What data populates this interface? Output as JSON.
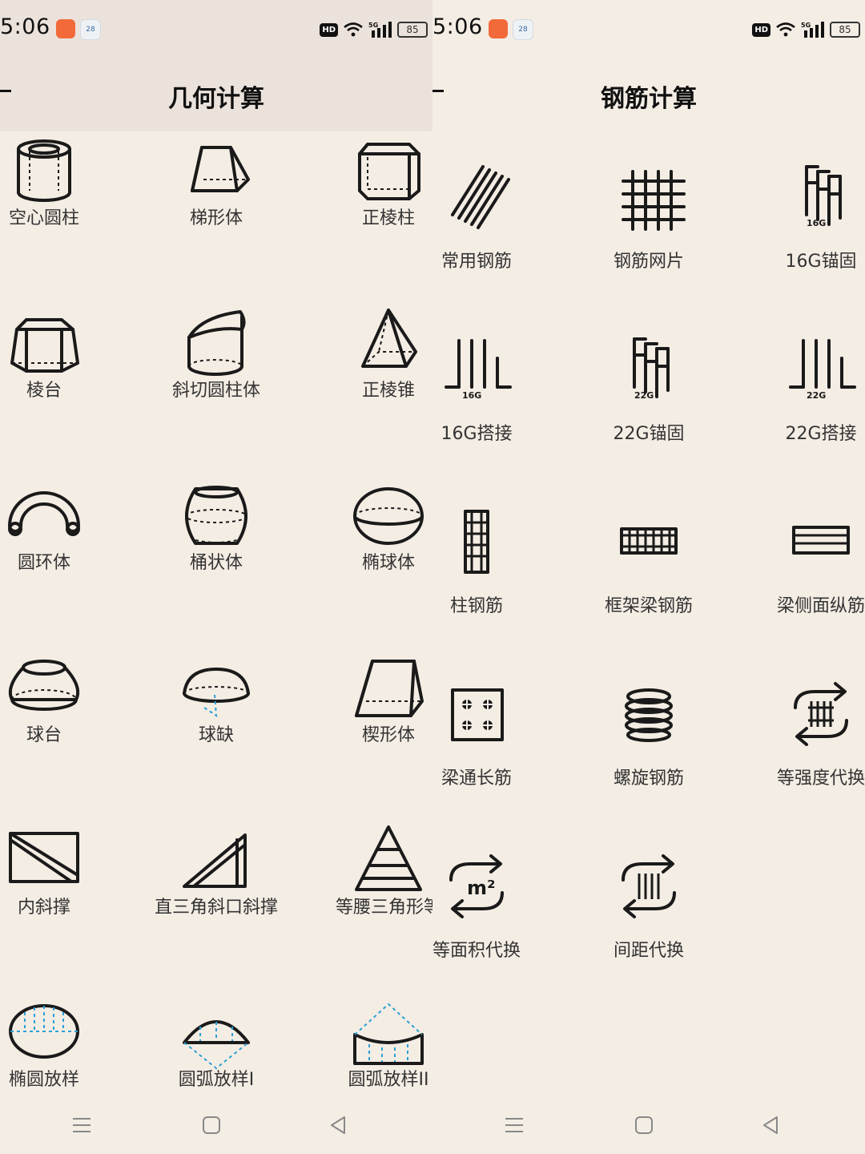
{
  "left": {
    "status": {
      "time": "5:06",
      "hd": "HD",
      "battery": "85"
    },
    "title": "几何计算",
    "items": [
      {
        "label": "空心圆柱",
        "icon": "hollow-cylinder-icon"
      },
      {
        "label": "梯形体",
        "icon": "trapezoid-solid-icon"
      },
      {
        "label": "正棱柱",
        "icon": "regular-prism-icon"
      },
      {
        "label": "棱台",
        "icon": "frustum-icon"
      },
      {
        "label": "斜切圆柱体",
        "icon": "oblique-cylinder-icon"
      },
      {
        "label": "正棱锥",
        "icon": "pyramid-icon"
      },
      {
        "label": "圆环体",
        "icon": "torus-icon"
      },
      {
        "label": "桶状体",
        "icon": "barrel-icon"
      },
      {
        "label": "椭球体",
        "icon": "ellipsoid-icon"
      },
      {
        "label": "球台",
        "icon": "spherical-frustum-icon"
      },
      {
        "label": "球缺",
        "icon": "spherical-cap-icon"
      },
      {
        "label": "楔形体",
        "icon": "wedge-icon"
      },
      {
        "label": "内斜撑",
        "icon": "inner-brace-icon"
      },
      {
        "label": "直三角斜口斜撑",
        "icon": "right-triangle-brace-icon"
      },
      {
        "label": "等腰三角形等",
        "icon": "isosceles-triangle-icon"
      },
      {
        "label": "椭圆放样",
        "icon": "ellipse-layout-icon"
      },
      {
        "label": "圆弧放样I",
        "icon": "arc-layout-1-icon"
      },
      {
        "label": "圆弧放样II",
        "icon": "arc-layout-2-icon"
      }
    ]
  },
  "right": {
    "status": {
      "time": "5:06",
      "hd": "HD",
      "battery": "85"
    },
    "title": "钢筋计算",
    "items": [
      {
        "label": "常用钢筋",
        "icon": "rebar-icon"
      },
      {
        "label": "钢筋网片",
        "icon": "rebar-mesh-icon"
      },
      {
        "label": "16G锚固",
        "icon": "anchor-16g-icon",
        "tag": "16G"
      },
      {
        "label": "16G搭接",
        "icon": "lap-16g-icon",
        "tag": "16G"
      },
      {
        "label": "22G锚固",
        "icon": "anchor-22g-icon",
        "tag": "22G"
      },
      {
        "label": "22G搭接",
        "icon": "lap-22g-icon",
        "tag": "22G"
      },
      {
        "label": "柱钢筋",
        "icon": "column-rebar-icon"
      },
      {
        "label": "框架梁钢筋",
        "icon": "frame-beam-rebar-icon"
      },
      {
        "label": "梁侧面纵筋",
        "icon": "beam-side-rebar-icon"
      },
      {
        "label": "梁通长筋",
        "icon": "beam-through-rebar-icon"
      },
      {
        "label": "螺旋钢筋",
        "icon": "spiral-rebar-icon"
      },
      {
        "label": "等强度代换",
        "icon": "equal-strength-swap-icon"
      },
      {
        "label": "等面积代换",
        "icon": "equal-area-swap-icon",
        "tag": "m²"
      },
      {
        "label": "间距代换",
        "icon": "spacing-swap-icon"
      }
    ]
  },
  "nav": {
    "menu": "menu-icon",
    "home": "home-icon",
    "back": "back-icon"
  },
  "colors": {
    "background": "#f4ede4",
    "left_header": "#ebe2dc",
    "app_orange": "#f26a3a",
    "accent_blue": "#2a9fd6"
  }
}
